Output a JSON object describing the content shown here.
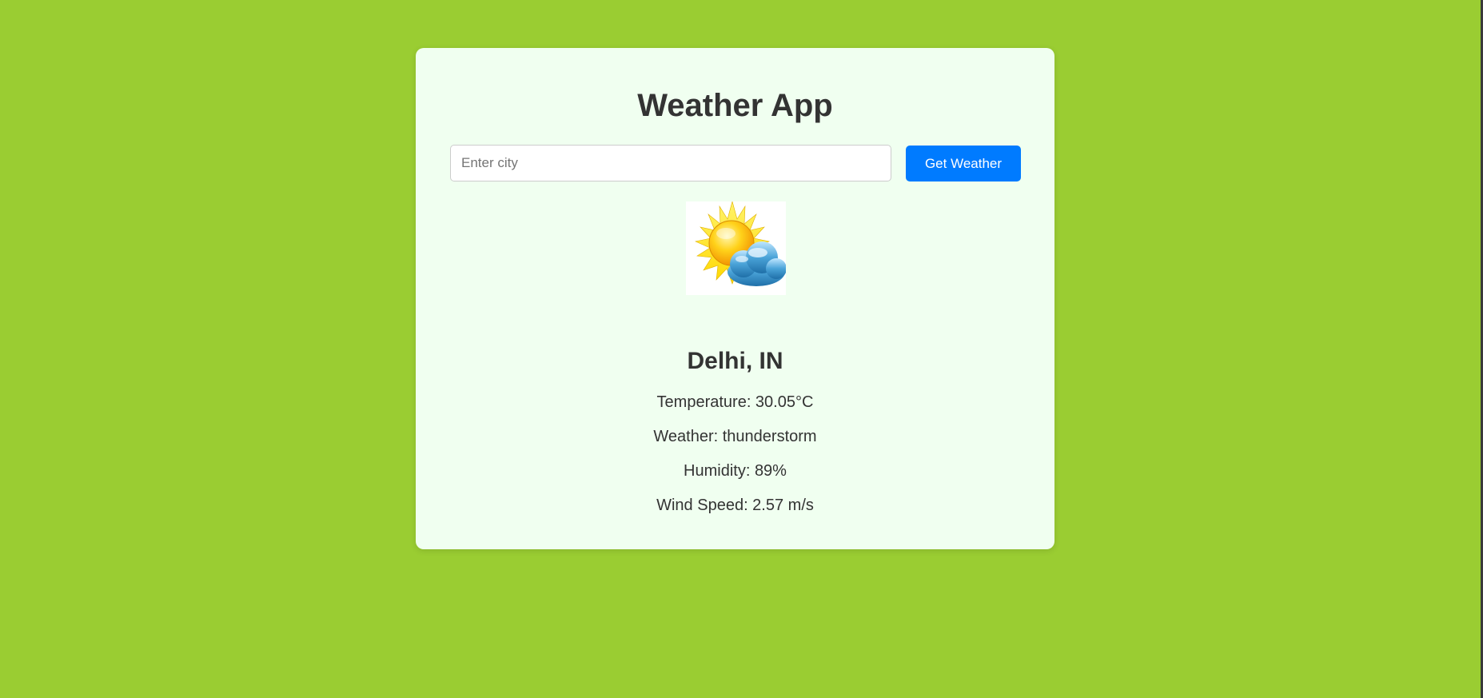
{
  "app": {
    "title": "Weather App"
  },
  "search": {
    "placeholder": "Enter city",
    "value": "",
    "button_label": "Get Weather"
  },
  "weather": {
    "icon": "partly-cloudy-sun-icon",
    "city": "Delhi, IN",
    "temperature": "Temperature: 30.05°C",
    "condition": "Weather: thunderstorm",
    "humidity": "Humidity: 89%",
    "wind_speed": "Wind Speed: 2.57 m/s"
  },
  "colors": {
    "page_background": "#9acd32",
    "card_background": "#f0fff0",
    "button": "#007bff",
    "text": "#333333"
  }
}
